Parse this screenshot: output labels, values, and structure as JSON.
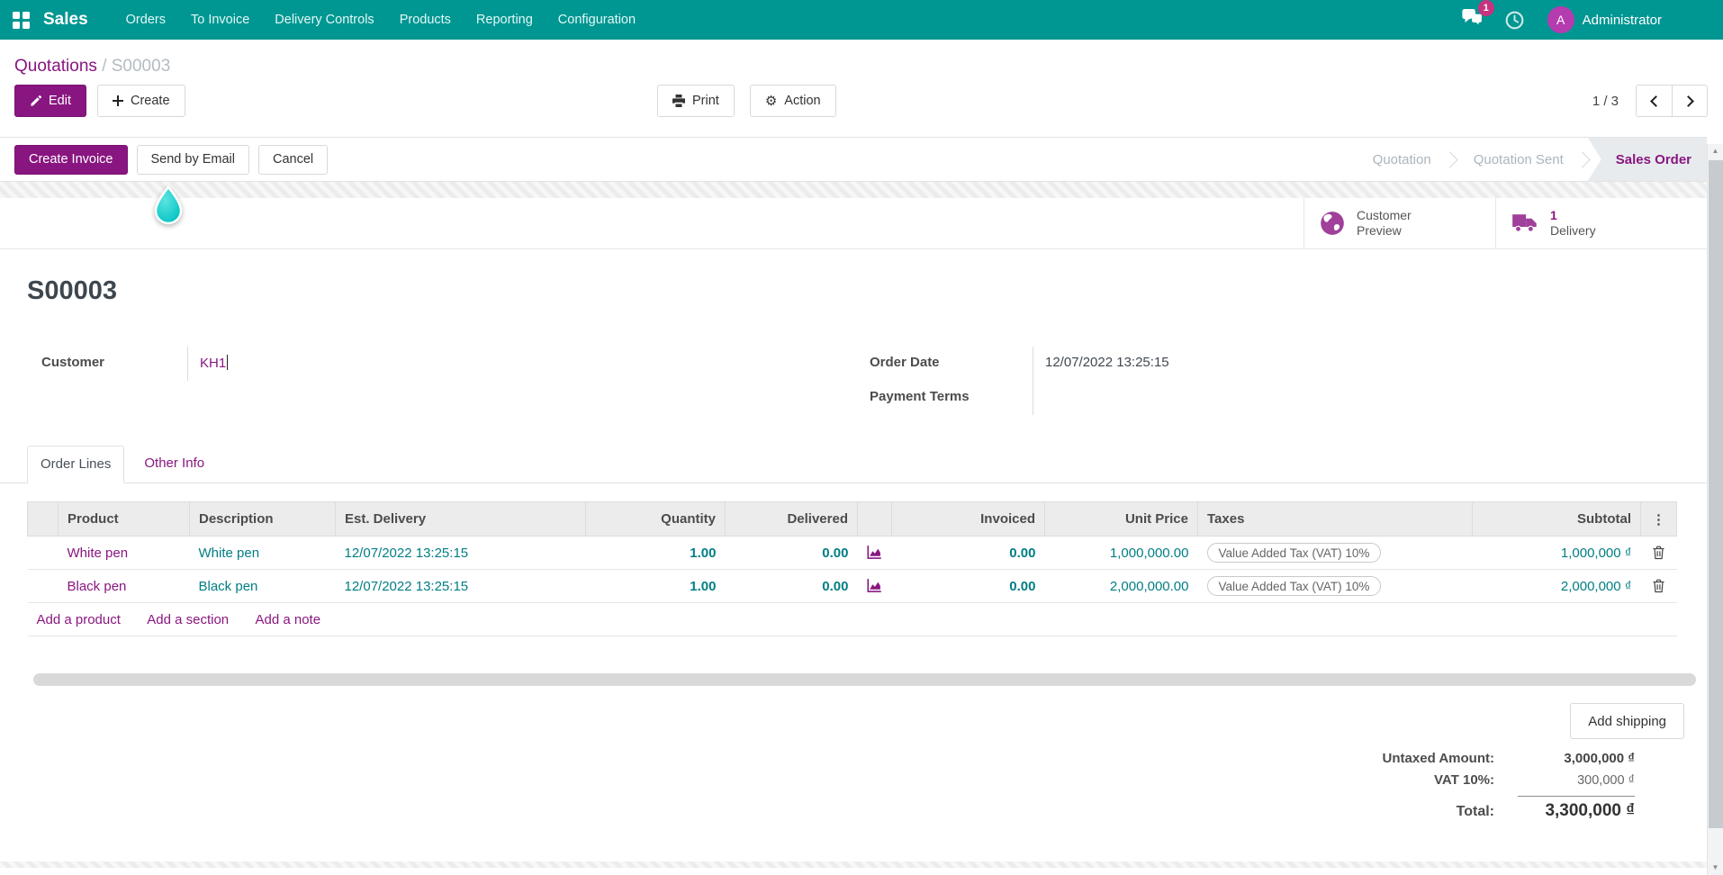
{
  "nav": {
    "app_name": "Sales",
    "menus": [
      "Orders",
      "To Invoice",
      "Delivery Controls",
      "Products",
      "Reporting",
      "Configuration"
    ],
    "messages_badge": "1",
    "user_initial": "A",
    "user_name": "Administrator"
  },
  "breadcrumb": {
    "parent": "Quotations",
    "separator": "/",
    "current": "S00003"
  },
  "control_panel": {
    "edit_label": "Edit",
    "create_label": "Create",
    "print_label": "Print",
    "action_label": "Action",
    "pager_value": "1 / 3"
  },
  "statusbar": {
    "create_invoice_label": "Create Invoice",
    "send_by_email_label": "Send by Email",
    "cancel_label": "Cancel",
    "states": [
      {
        "label": "Quotation"
      },
      {
        "label": "Quotation Sent"
      },
      {
        "label": "Sales Order"
      }
    ]
  },
  "stat_buttons": {
    "customer_preview_line1": "Customer",
    "customer_preview_line2": "Preview",
    "delivery_count": "1",
    "delivery_label": "Delivery"
  },
  "sheet": {
    "title": "S00003",
    "fields": {
      "customer_label": "Customer",
      "customer_value": "KH1",
      "order_date_label": "Order Date",
      "order_date_value": "12/07/2022 13:25:15",
      "payment_terms_label": "Payment Terms",
      "payment_terms_value": ""
    }
  },
  "tabs": {
    "order_lines": "Order Lines",
    "other_info": "Other Info"
  },
  "order_lines": {
    "columns": {
      "product": "Product",
      "description": "Description",
      "est_delivery": "Est. Delivery",
      "quantity": "Quantity",
      "delivered": "Delivered",
      "invoiced": "Invoiced",
      "unit_price": "Unit Price",
      "taxes": "Taxes",
      "subtotal": "Subtotal",
      "options": "⋮"
    },
    "rows": [
      {
        "product": "White pen",
        "description": "White pen",
        "est_delivery": "12/07/2022 13:25:15",
        "quantity": "1.00",
        "delivered": "0.00",
        "invoiced": "0.00",
        "unit_price": "1,000,000.00",
        "taxes": "Value Added Tax (VAT) 10%",
        "subtotal": "1,000,000 ₫"
      },
      {
        "product": "Black pen",
        "description": "Black pen",
        "est_delivery": "12/07/2022 13:25:15",
        "quantity": "1.00",
        "delivered": "0.00",
        "invoiced": "0.00",
        "unit_price": "2,000,000.00",
        "taxes": "Value Added Tax (VAT) 10%",
        "subtotal": "2,000,000 ₫"
      }
    ],
    "footer_links": {
      "add_product": "Add a product",
      "add_section": "Add a section",
      "add_note": "Add a note"
    }
  },
  "totals": {
    "add_shipping_label": "Add shipping",
    "untaxed_label": "Untaxed Amount:",
    "untaxed_value": "3,000,000 ₫",
    "vat_label": "VAT 10%:",
    "vat_value": "300,000 ₫",
    "total_label": "Total:",
    "total_value": "3,300,000 ₫"
  },
  "colors": {
    "nav_teal": "#009691",
    "brand_purple": "#891680",
    "editable_teal": "#017E84",
    "badge_pink": "#C7337E",
    "avatar_magenta": "#B43BB0",
    "stat_icon_purple": "#A0409A",
    "drop_cyan": "#0CC9C9",
    "status_active_bg": "#E8EBEE"
  }
}
